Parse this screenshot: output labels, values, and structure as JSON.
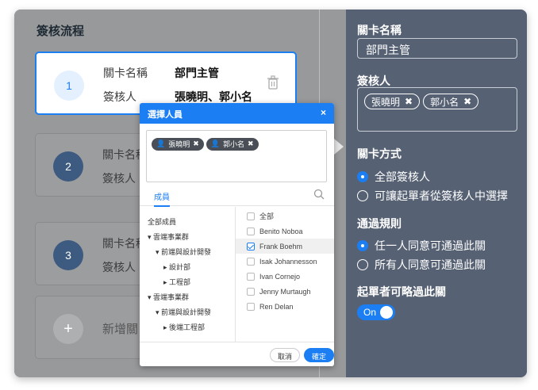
{
  "flow": {
    "title": "簽核流程",
    "cards": [
      {
        "number": "1",
        "label_name": "關卡名稱",
        "value_name": "部門主管",
        "label_approver": "簽核人",
        "value_approver": "張曉明、郭小名"
      },
      {
        "number": "2",
        "label_name": "關卡名稱",
        "label_approver": "簽核人"
      },
      {
        "number": "3",
        "label_name": "關卡名稱",
        "label_approver": "簽核人"
      }
    ],
    "add": {
      "icon": "+",
      "label": "新增關"
    }
  },
  "modal": {
    "title": "選擇人員",
    "close": "×",
    "selected": [
      "張曉明",
      "郭小名"
    ],
    "tab": "成員",
    "tree": [
      "全部成員",
      "雲端事業群",
      "前端與設計開發",
      "設計部",
      "工程部",
      "雲端事業群",
      "前端與設計開發",
      "後端工程部"
    ],
    "members": [
      {
        "name": "全部",
        "checked": false
      },
      {
        "name": "Benito Noboa",
        "checked": false
      },
      {
        "name": "Frank Boehm",
        "checked": true
      },
      {
        "name": "Isak Johannesson",
        "checked": false
      },
      {
        "name": "Ivan Cornejo",
        "checked": false
      },
      {
        "name": "Jenny Murtaugh",
        "checked": false
      },
      {
        "name": "Ren Delan",
        "checked": false
      }
    ],
    "cancel": "取消",
    "confirm": "確定"
  },
  "settings": {
    "name_label": "關卡名稱",
    "name_value": "部門主管",
    "approver_label": "簽核人",
    "approvers": [
      "張曉明",
      "郭小名"
    ],
    "method_label": "關卡方式",
    "method_options": [
      {
        "label": "全部簽核人",
        "selected": true
      },
      {
        "label": "可讓起單者從簽核人中選擇",
        "selected": false
      }
    ],
    "rule_label": "通過規則",
    "rule_options": [
      {
        "label": "任一人同意可通過此關",
        "selected": true
      },
      {
        "label": "所有人同意可通過此關",
        "selected": false
      }
    ],
    "skip_label": "起單者可略過此關",
    "skip_toggle": "On"
  }
}
